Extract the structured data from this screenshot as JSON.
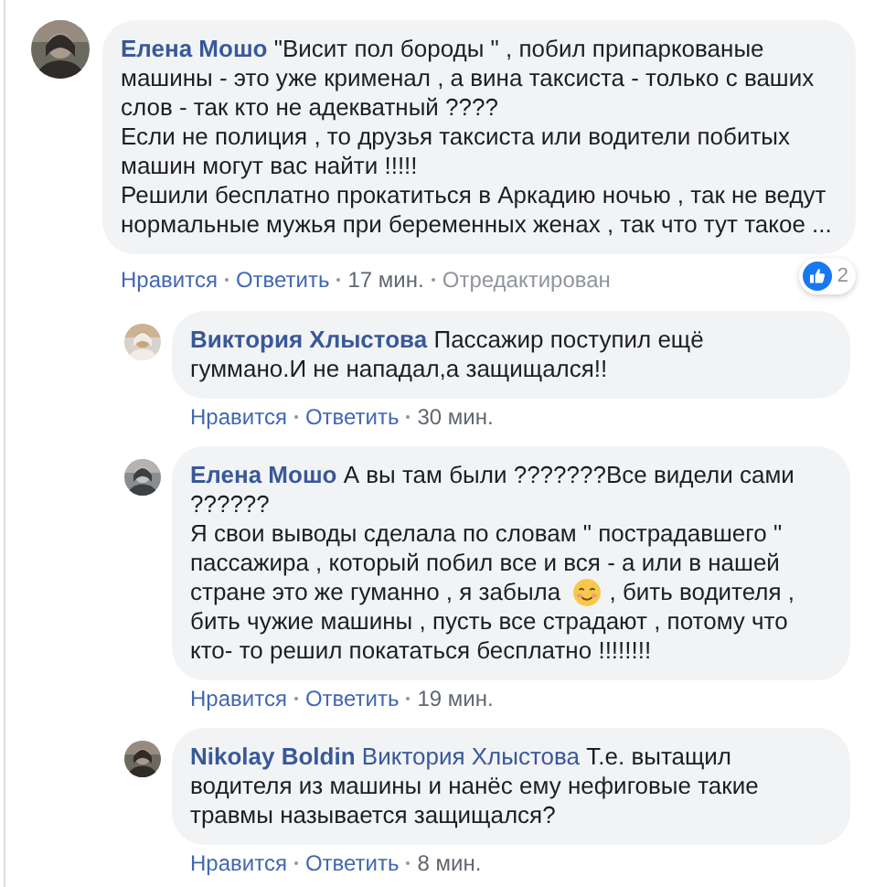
{
  "comments": [
    {
      "author": "Елена Мошо",
      "paragraphs": [
        [
          {
            "kind": "text",
            "text": "\"Висит пол бороды \" , побил припаркованые машины - это уже крименал , а вина таксиста - только с ваших слов - так кто не адекватный ????"
          }
        ],
        [
          {
            "kind": "text",
            "text": "Если не полиция , то друзья таксиста или водители побитых машин могут вас найти !!!!!"
          }
        ],
        [
          {
            "kind": "text",
            "text": "Решили бесплатно прокатиться в Аркадию ночью , так не ведут нормальные мужья при беременных женах , так что тут такое ..."
          }
        ]
      ],
      "actions": [
        {
          "kind": "link",
          "text": "Нравится"
        },
        {
          "kind": "link",
          "text": "Ответить"
        },
        {
          "kind": "time",
          "text": "17 мин."
        },
        {
          "kind": "note",
          "text": "Отредактирован"
        }
      ],
      "reactions": {
        "count": "2"
      },
      "replies": [
        {
          "author": "Виктория Хлыстова",
          "paragraphs": [
            [
              {
                "kind": "text",
                "text": "Пассажир поступил ещё гуммано.И не нападал,а защищался!!"
              }
            ]
          ],
          "actions": [
            {
              "kind": "link",
              "text": "Нравится"
            },
            {
              "kind": "link",
              "text": "Ответить"
            },
            {
              "kind": "time",
              "text": "30 мин."
            }
          ]
        },
        {
          "author": "Елена Мошо",
          "paragraphs": [
            [
              {
                "kind": "text",
                "text": "А вы там были ???????Все видели сами ??????"
              }
            ],
            [
              {
                "kind": "text",
                "text": "Я свои выводы сделала по словам \" пострадавшего \" пассажира , который побил все и вся - а или в нашей стране это же гуманно , я забыла"
              },
              {
                "kind": "emoji"
              },
              {
                "kind": "text",
                "text": ", бить водителя , бить чужие машины , пусть все страдают , потому что кто- то решил покататься бесплатно !!!!!!!!"
              }
            ]
          ],
          "actions": [
            {
              "kind": "link",
              "text": "Нравится"
            },
            {
              "kind": "link",
              "text": "Ответить"
            },
            {
              "kind": "time",
              "text": "19 мин."
            }
          ]
        },
        {
          "author": "Nikolay Boldin",
          "paragraphs": [
            [
              {
                "kind": "mention",
                "text": "Виктория Хлыстова"
              },
              {
                "kind": "text",
                "text": "Т.е. вытащил водителя из машины и нанёс ему нефиговые такие травмы называется защищался?"
              }
            ]
          ],
          "actions": [
            {
              "kind": "link",
              "text": "Нравится"
            },
            {
              "kind": "link",
              "text": "Ответить"
            },
            {
              "kind": "time",
              "text": "8 мин."
            }
          ]
        }
      ]
    }
  ]
}
